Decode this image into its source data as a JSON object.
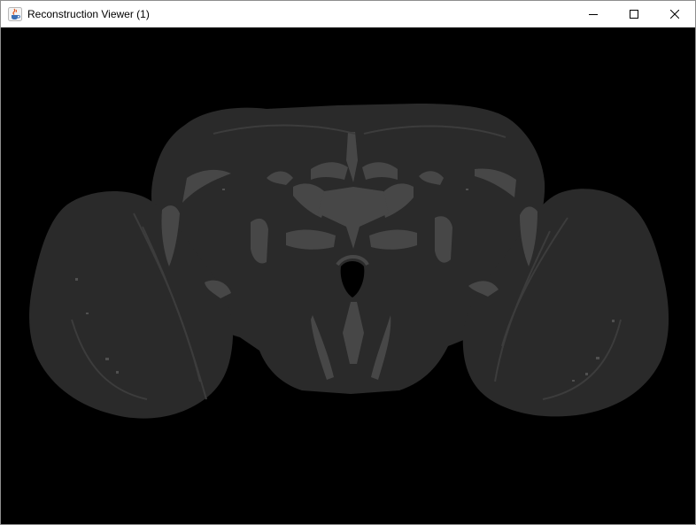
{
  "window": {
    "title": "Reconstruction Viewer (1)",
    "app_icon": "java-coffee-cup-icon",
    "controls": [
      "minimize-icon",
      "maximize-icon",
      "close-icon"
    ]
  },
  "viewport": {
    "background_color": "#000000",
    "mesh_color": "#2a2a2a",
    "mesh_highlight_color": "#4a4a4a",
    "content": "brain-mesh-3d-render"
  }
}
